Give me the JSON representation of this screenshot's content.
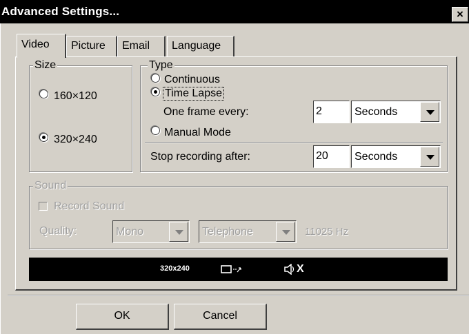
{
  "window": {
    "title": "Advanced Settings...",
    "close_glyph": "×"
  },
  "tabs": [
    {
      "label": "Video",
      "selected": true
    },
    {
      "label": "Picture",
      "selected": false
    },
    {
      "label": "Email",
      "selected": false
    },
    {
      "label": "Language",
      "selected": false
    }
  ],
  "size_group": {
    "label": "Size",
    "options": [
      {
        "label": "160×120",
        "checked": false
      },
      {
        "label": "320×240",
        "checked": true
      }
    ]
  },
  "type_group": {
    "label": "Type",
    "options": [
      {
        "label": "Continuous",
        "checked": false
      },
      {
        "label": "Time Lapse",
        "checked": true
      },
      {
        "label": "Manual Mode",
        "checked": false
      }
    ],
    "frame_label": "One frame every:",
    "frame_value": "2",
    "frame_unit": "Seconds",
    "stop_label": "Stop recording after:",
    "stop_value": "20",
    "stop_unit": "Seconds"
  },
  "sound_group": {
    "label": "Sound",
    "record_label": "Record Sound",
    "record_checked": false,
    "quality_label": "Quality:",
    "channel": "Mono",
    "quality": "Telephone",
    "rate": "11025 Hz"
  },
  "status_bar": {
    "resolution": "320x240",
    "screen_icon": "screen-arrows-icon",
    "sound_icon": "speaker-muted-icon",
    "muted_glyph": "X"
  },
  "buttons": {
    "ok": "OK",
    "cancel": "Cancel"
  }
}
